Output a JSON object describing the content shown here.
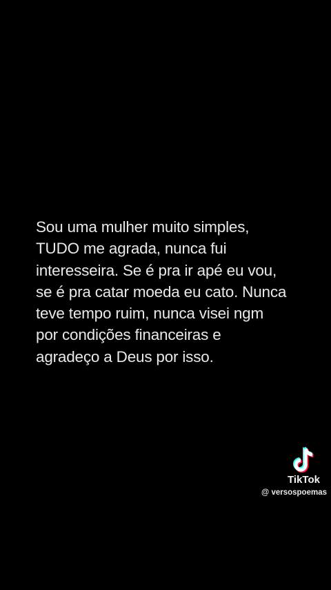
{
  "post": {
    "lines": [
      "Sou uma mulher muito simples,",
      "TUDO me agrada, nunca fui",
      "interesseira. Se é pra ir apé eu vou,",
      "se é pra catar moeda eu cato. Nunca",
      "teve tempo ruim, nunca visei ngm",
      "por condições financeiras e",
      "agradeço a Deus por isso."
    ]
  },
  "watermark": {
    "icon": "tiktok-logo-icon",
    "brand": "TikTok",
    "handle": "@ versospoemas"
  },
  "colors": {
    "background": "#000000",
    "text": "#e9e9e9",
    "logo_cyan": "#25f4ee",
    "logo_red": "#fe2c55",
    "logo_white": "#ffffff"
  }
}
